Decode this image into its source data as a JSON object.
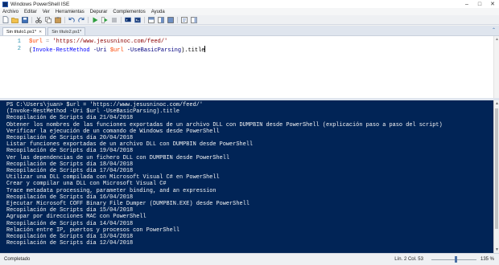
{
  "window": {
    "title": "Windows PowerShell ISE"
  },
  "menu": [
    "Archivo",
    "Editar",
    "Ver",
    "Herramientas",
    "Depurar",
    "Complementos",
    "Ayuda"
  ],
  "toolbar": {
    "icons": [
      "new-file-icon",
      "open-file-icon",
      "save-icon",
      "cut-icon",
      "copy-icon",
      "paste-icon",
      "undo-icon",
      "redo-icon",
      "run-script-icon",
      "run-selection-icon",
      "stop-icon",
      "new-remote-tab-icon",
      "start-powershell-icon",
      "layout-top-icon",
      "layout-right-icon",
      "layout-max-icon",
      "show-commands-icon",
      "show-addon-icon"
    ]
  },
  "tabs": [
    {
      "label": "Sin título1.ps1*",
      "active": true
    },
    {
      "label": "Sin título2.ps1*",
      "active": false
    }
  ],
  "editor": {
    "line_numbers": [
      "1",
      "2"
    ],
    "line1": {
      "var": "$url",
      "op": " = ",
      "str": "'https://www.jesusninoc.com/feed/'"
    },
    "line2": {
      "open": "(",
      "cmd": "Invoke-RestMethod",
      "p1": " -Uri ",
      "var": "$url",
      "p2": " -UseBasicParsing",
      "close": ").title"
    }
  },
  "console": {
    "lines": [
      "PS C:\\Users\\juan> $url = 'https://www.jesusninoc.com/feed/'",
      "(Invoke-RestMethod -Uri $url -UseBasicParsing).title",
      "Recopilación de Scripts día 21/04/2018",
      "Obtener los nombres de las funciones exportadas de un archivo DLL con DUMPBIN desde PowerShell (explicación paso a paso del script)",
      "Verificar la ejecución de un comando de Windows desde PowerShell",
      "Recopilación de Scripts día 20/04/2018",
      "Listar funciones exportadas de un archivo DLL con DUMPBIN desde PowerShell",
      "Recopilación de Scripts día 19/04/2018",
      "Ver las dependencias de un fichero DLL con DUMPBIN desde PowerShell",
      "Recopilación de Scripts día 18/04/2018",
      "Recopilación de Scripts día 17/04/2018",
      "Utilizar una DLL compilada con Microsoft Visual C# en PowerShell",
      "Crear y compilar una DLL con Microsoft Visual C#",
      "Trace metadata processing, parameter binding, and an expression",
      "Recopilación de Scripts día 16/04/2018",
      "Ejecutar Microsoft COFF Binary File Dumper (DUMPBIN.EXE) desde PowerShell",
      "Recopilación de Scripts día 15/04/2018",
      "Agrupar por direcciones MAC con PowerShell",
      "Recopilación de Scripts día 14/04/2018",
      "Relación entre IP, puertos y procesos con PowerShell",
      "Recopilación de Scripts día 13/04/2018",
      "Recopilación de Scripts día 12/04/2018"
    ]
  },
  "status": {
    "text": "Completado",
    "position": "Lín. 2  Col. 53",
    "zoom": "135 %",
    "zoom_fraction": 0.55
  },
  "colors": {
    "console_bg": "#012456",
    "console_fg": "#f5f5f5",
    "variable": "#ff4500",
    "string": "#8b0000",
    "command": "#0000ff",
    "parameter": "#000080"
  }
}
